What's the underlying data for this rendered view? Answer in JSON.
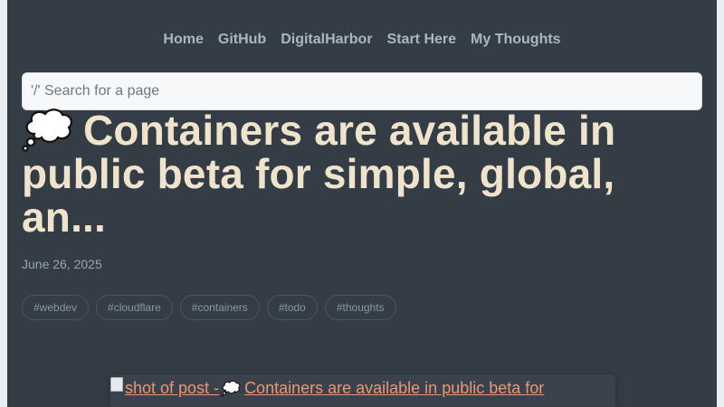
{
  "nav": {
    "items": [
      "Home",
      "GitHub",
      "DigitalHarbor",
      "Start Here",
      "My Thoughts"
    ]
  },
  "search": {
    "placeholder": "'/' Search for a page"
  },
  "post": {
    "title": "Containers are available in public beta for simple, global, an...",
    "title_icon": "thought-balloon-icon",
    "date": "June 26, 2025",
    "tags": [
      "#webdev",
      "#cloudflare",
      "#containers",
      "#todo",
      "#thoughts"
    ],
    "screenshot_link": {
      "prefix": "shot of post - ",
      "text": "Containers are available in public beta for"
    }
  },
  "colors": {
    "background": "#343c45",
    "title": "#efe4cb",
    "nav": "#a8b7c6",
    "link": "#f0956f"
  }
}
